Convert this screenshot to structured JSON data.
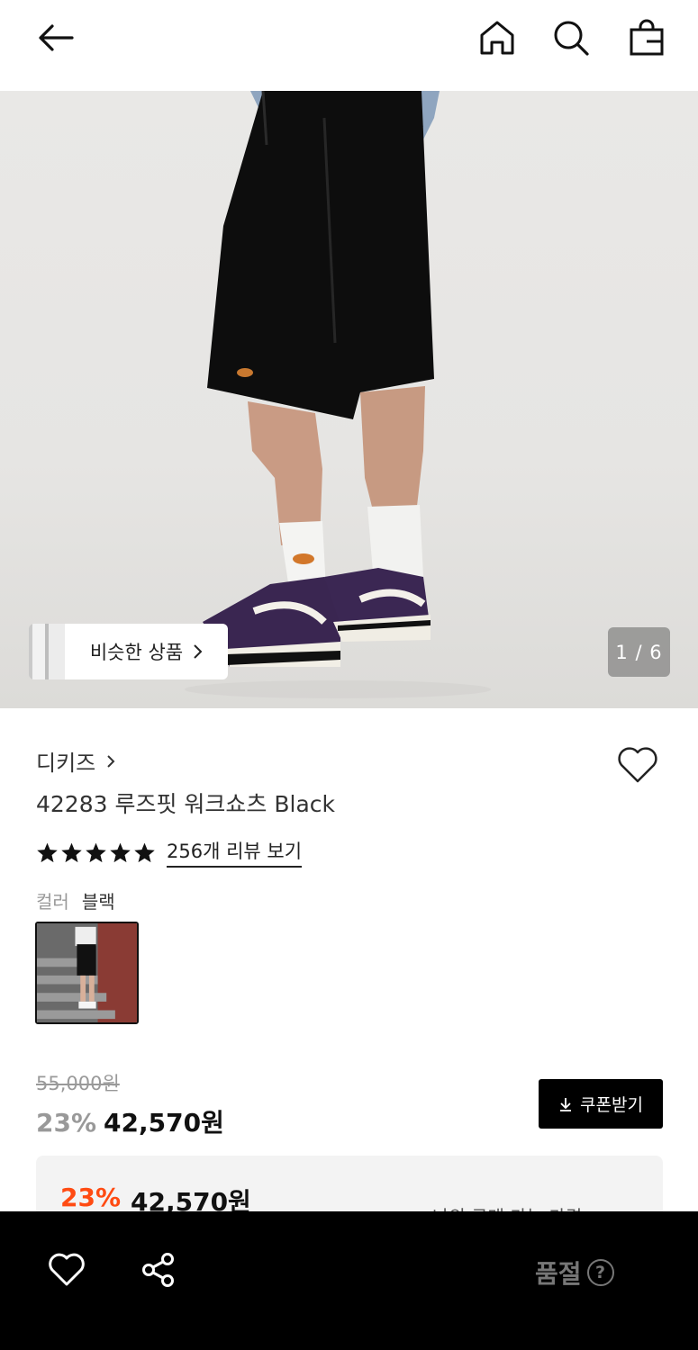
{
  "header": {
    "back_icon": "back-arrow-icon",
    "home_icon": "home-icon",
    "search_icon": "search-icon",
    "cart_icon": "shopping-bag-icon"
  },
  "hero": {
    "similar_label": "비슷한 상품",
    "image_counter": "1 / 6"
  },
  "product": {
    "brand": "디키즈",
    "title": "42283 루즈핏 워크쇼츠 Black",
    "rating_stars": 5,
    "review_link": "256개 리뷰 보기",
    "color_label": "컬러",
    "color_value": "블랙"
  },
  "price": {
    "original": "55,000원",
    "discount_pct": "23%",
    "sale": "42,570원",
    "coupon_label": "쿠폰받기"
  },
  "my_price": {
    "discount_pct": "23%",
    "sale": "42,570원",
    "link_label": "나의 구매 가능 가격"
  },
  "bottom_bar": {
    "soldout_label": "품절",
    "help_glyph": "?"
  },
  "colors": {
    "accent_discount": "#ff4b12",
    "bottom_bar_bg": "#000000"
  }
}
